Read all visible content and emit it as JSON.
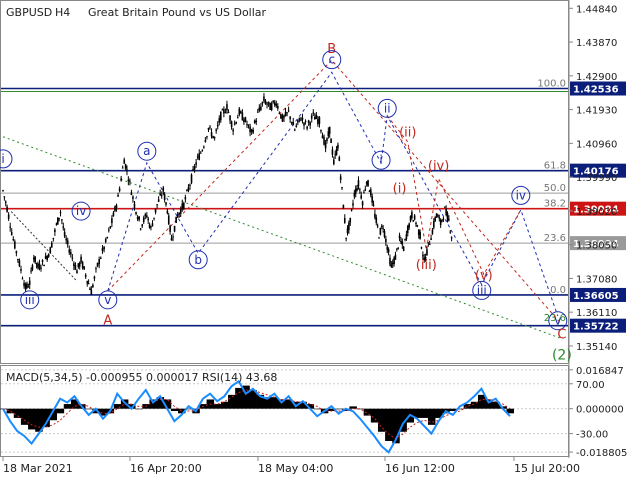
{
  "header": {
    "symbol": "GBPUSD",
    "timeframe": "H4",
    "description": "Great Britain Pound vs US Dollar"
  },
  "colors": {
    "background": "#ffffff",
    "candle": "#000000",
    "wave_blue": "#1f2fb0",
    "wave_red": "#c0281e",
    "wave_green": "#2b8a2b",
    "level_blue": "#0b1f7a",
    "level_red": "#cc1414",
    "level_gray": "#9a9a9a",
    "trend_green": "#2e8b2e",
    "macd_hist": "#000000",
    "macd_signal": "#1a8cff",
    "rsi": "#cc2222",
    "axis_text": "#222222"
  },
  "chart_data": [
    {
      "type": "candlestick",
      "title": "GBPUSD, H4:  Great Britain Pound vs US Dollar",
      "ylim": [
        1.3465,
        1.4505
      ],
      "y_ticks": [
        "1.44840",
        "1.43870",
        "1.42900",
        "1.41930",
        "1.40960",
        "1.39990",
        "1.39020",
        "1.38050",
        "1.37080",
        "1.36110",
        "1.35140"
      ],
      "x_ticks": [
        "18 Mar 2021",
        "16 Apr 20:00",
        "18 May 04:00",
        "16 Jun 12:00",
        "15 Jul 20:00"
      ],
      "price_path": [
        [
          0,
          1.396
        ],
        [
          2,
          1.391
        ],
        [
          5,
          1.382
        ],
        [
          8,
          1.375
        ],
        [
          11,
          1.368
        ],
        [
          13,
          1.3695
        ],
        [
          15,
          1.377
        ],
        [
          17,
          1.374
        ],
        [
          20,
          1.3755
        ],
        [
          23,
          1.379
        ],
        [
          26,
          1.386
        ],
        [
          28,
          1.39
        ],
        [
          30,
          1.383
        ],
        [
          33,
          1.378
        ],
        [
          36,
          1.373
        ],
        [
          38,
          1.376
        ],
        [
          41,
          1.3705
        ],
        [
          43,
          1.367
        ],
        [
          46,
          1.3745
        ],
        [
          50,
          1.381
        ],
        [
          53,
          1.387
        ],
        [
          56,
          1.394
        ],
        [
          59,
          1.405
        ],
        [
          61,
          1.4
        ],
        [
          64,
          1.392
        ],
        [
          67,
          1.386
        ],
        [
          70,
          1.389
        ],
        [
          72,
          1.385
        ],
        [
          75,
          1.392
        ],
        [
          78,
          1.396
        ],
        [
          80,
          1.3905
        ],
        [
          82,
          1.382
        ],
        [
          85,
          1.389
        ],
        [
          88,
          1.392
        ],
        [
          91,
          1.398
        ],
        [
          94,
          1.404
        ],
        [
          97,
          1.408
        ],
        [
          100,
          1.414
        ],
        [
          103,
          1.411
        ],
        [
          106,
          1.4175
        ],
        [
          109,
          1.42
        ],
        [
          112,
          1.414
        ],
        [
          115,
          1.4185
        ],
        [
          118,
          1.416
        ],
        [
          121,
          1.4125
        ],
        [
          124,
          1.418
        ],
        [
          127,
          1.422
        ],
        [
          130,
          1.42
        ],
        [
          133,
          1.4215
        ],
        [
          136,
          1.4165
        ],
        [
          139,
          1.4185
        ],
        [
          142,
          1.4135
        ],
        [
          145,
          1.417
        ],
        [
          148,
          1.4145
        ],
        [
          151,
          1.4175
        ],
        [
          154,
          1.416
        ],
        [
          157,
          1.4085
        ],
        [
          159,
          1.4135
        ],
        [
          161,
          1.404
        ],
        [
          163,
          1.409
        ],
        [
          165,
          1.396
        ],
        [
          167,
          1.383
        ],
        [
          169,
          1.387
        ],
        [
          171,
          1.395
        ],
        [
          173,
          1.398
        ],
        [
          175,
          1.393
        ],
        [
          177,
          1.399
        ],
        [
          179,
          1.3955
        ],
        [
          181,
          1.389
        ],
        [
          183,
          1.3835
        ],
        [
          185,
          1.386
        ],
        [
          187,
          1.38
        ],
        [
          189,
          1.374
        ],
        [
          191,
          1.377
        ],
        [
          193,
          1.382
        ],
        [
          195,
          1.3795
        ],
        [
          197,
          1.385
        ],
        [
          199,
          1.389
        ],
        [
          201,
          1.387
        ],
        [
          203,
          1.383
        ],
        [
          205,
          1.3755
        ],
        [
          207,
          1.38
        ],
        [
          209,
          1.3845
        ],
        [
          211,
          1.3895
        ],
        [
          213,
          1.3865
        ],
        [
          215,
          1.3905
        ],
        [
          217,
          1.3875
        ],
        [
          219,
          1.381
        ]
      ],
      "price_levels": [
        {
          "label": "1.42536",
          "value": 1.42536,
          "color": "#0b1f7a"
        },
        {
          "label": "1.40176",
          "value": 1.40176,
          "color": "#0b1f7a"
        },
        {
          "label": "1.39084",
          "value": 1.39084,
          "color": "#cc1414"
        },
        {
          "label": "1.38094",
          "value": 1.38094,
          "color": "#9a9a9a"
        },
        {
          "label": "1.36605",
          "value": 1.36605,
          "color": "#0b1f7a"
        },
        {
          "label": "1.35722",
          "value": 1.35722,
          "color": "#0b1f7a"
        }
      ],
      "fib_levels": [
        {
          "label": "100.0",
          "value": 1.42536
        },
        {
          "label": "61.8",
          "value": 1.40176
        },
        {
          "label": "50.0",
          "value": 1.39531
        },
        {
          "label": "38.2",
          "value": 1.39084
        },
        {
          "label": "23.6",
          "value": 1.38094
        },
        {
          "label": "0.0",
          "value": 1.36605
        }
      ],
      "fib_ext_label": "23.6",
      "wave_labels": [
        {
          "label": "i",
          "x": 0,
          "y": 1.404,
          "style": "circle",
          "color": "blue"
        },
        {
          "label": "iii",
          "x": 13,
          "y": 1.3635,
          "style": "circle",
          "color": "blue"
        },
        {
          "label": "iv",
          "x": 38,
          "y": 1.389,
          "style": "circle",
          "color": "blue"
        },
        {
          "label": "v",
          "x": 51,
          "y": 1.3635,
          "style": "circle",
          "color": "blue"
        },
        {
          "label": "A",
          "x": 51,
          "y": 1.3575,
          "style": "plain",
          "color": "red"
        },
        {
          "label": "a",
          "x": 70,
          "y": 1.4062,
          "style": "circle",
          "color": "blue"
        },
        {
          "label": "b",
          "x": 95,
          "y": 1.375,
          "style": "circle",
          "color": "blue"
        },
        {
          "label": "B",
          "x": 160,
          "y": 1.4355,
          "style": "plain",
          "color": "red"
        },
        {
          "label": "c",
          "x": 160,
          "y": 1.4325,
          "style": "circle",
          "color": "blue"
        },
        {
          "label": "ii",
          "x": 187,
          "y": 1.4185,
          "style": "circle",
          "color": "blue"
        },
        {
          "label": "i",
          "x": 184,
          "y": 1.4036,
          "style": "circle",
          "color": "blue"
        },
        {
          "label": "(ii)",
          "x": 197,
          "y": 1.4116,
          "style": "plain",
          "color": "red"
        },
        {
          "label": "(i)",
          "x": 193,
          "y": 1.3955,
          "style": "plain",
          "color": "red"
        },
        {
          "label": "(iv)",
          "x": 212,
          "y": 1.402,
          "style": "plain",
          "color": "red"
        },
        {
          "label": "(iii)",
          "x": 206,
          "y": 1.3735,
          "style": "plain",
          "color": "red"
        },
        {
          "label": "iii",
          "x": 233,
          "y": 1.3662,
          "style": "circle",
          "color": "blue"
        },
        {
          "label": "(v)",
          "x": 234,
          "y": 1.3705,
          "style": "plain",
          "color": "red"
        },
        {
          "label": "iv",
          "x": 252,
          "y": 1.3935,
          "style": "circle",
          "color": "blue"
        },
        {
          "label": "v",
          "x": 270,
          "y": 1.3575,
          "style": "circle",
          "color": "blue"
        },
        {
          "label": "C",
          "x": 272,
          "y": 1.3535,
          "style": "plain",
          "color": "red"
        },
        {
          "label": "(2)",
          "x": 272,
          "y": 1.3475,
          "style": "plain",
          "color": "green"
        }
      ]
    },
    {
      "type": "macd-rsi",
      "title": "MACD(5,34,5) -0.000955 0.000017 RSI(14) 43.68",
      "indicator_label": "MACD(5,34,5) -0.000955 0.000017 RSI(14) 43.68",
      "ylim": [
        -0.0205,
        0.0185
      ],
      "y_ticks": [
        "0.016847",
        "70.00",
        "0.000000",
        "-30.00",
        "-0.018805"
      ],
      "histogram": [
        0.0,
        -0.002,
        -0.004,
        -0.007,
        -0.009,
        -0.01,
        -0.008,
        -0.005,
        -0.002,
        0.002,
        0.004,
        0.002,
        0.0,
        -0.002,
        -0.003,
        -0.002,
        0.002,
        0.004,
        0.002,
        0.0,
        0.002,
        0.004,
        0.005,
        0.004,
        -0.001,
        -0.002,
        0.0,
        -0.002,
        0.002,
        0.004,
        0.002,
        0.003,
        0.006,
        0.009,
        0.01,
        0.008,
        0.006,
        0.005,
        0.005,
        0.004,
        0.004,
        0.003,
        0.003,
        0.002,
        0.0,
        -0.002,
        -0.001,
        0.0,
        -0.001,
        0.001,
        0.0,
        -0.003,
        -0.006,
        -0.01,
        -0.014,
        -0.015,
        -0.01,
        -0.006,
        -0.004,
        -0.004,
        -0.007,
        -0.004,
        -0.002,
        -0.001,
        0.0,
        0.002,
        0.003,
        0.006,
        0.004,
        0.003,
        0.001,
        -0.002
      ],
      "signal": [
        0.0,
        -0.001,
        -0.003,
        -0.005,
        -0.007,
        -0.008,
        -0.008,
        -0.007,
        -0.005,
        -0.002,
        0.001,
        0.002,
        0.001,
        -0.001,
        -0.002,
        -0.002,
        0.0,
        0.002,
        0.002,
        0.001,
        0.001,
        0.003,
        0.004,
        0.004,
        0.001,
        -0.001,
        -0.001,
        -0.001,
        0.001,
        0.002,
        0.002,
        0.003,
        0.005,
        0.007,
        0.008,
        0.008,
        0.007,
        0.006,
        0.005,
        0.004,
        0.004,
        0.003,
        0.003,
        0.002,
        0.001,
        -0.001,
        -0.001,
        -0.001,
        -0.001,
        0.0,
        0.0,
        -0.002,
        -0.004,
        -0.008,
        -0.011,
        -0.013,
        -0.011,
        -0.008,
        -0.006,
        -0.005,
        -0.006,
        -0.005,
        -0.003,
        -0.002,
        -0.001,
        0.001,
        0.002,
        0.004,
        0.004,
        0.003,
        0.002,
        0.0
      ],
      "rsi": [
        50,
        40,
        32,
        28,
        22,
        30,
        38,
        48,
        58,
        55,
        60,
        52,
        45,
        50,
        42,
        48,
        62,
        55,
        50,
        58,
        65,
        55,
        60,
        50,
        40,
        45,
        52,
        48,
        58,
        62,
        56,
        60,
        68,
        72,
        62,
        66,
        60,
        58,
        62,
        55,
        60,
        52,
        56,
        50,
        44,
        48,
        52,
        46,
        50,
        48,
        42,
        35,
        28,
        20,
        15,
        25,
        38,
        45,
        42,
        36,
        30,
        40,
        48,
        45,
        52,
        55,
        60,
        66,
        55,
        58,
        50,
        44
      ]
    }
  ]
}
